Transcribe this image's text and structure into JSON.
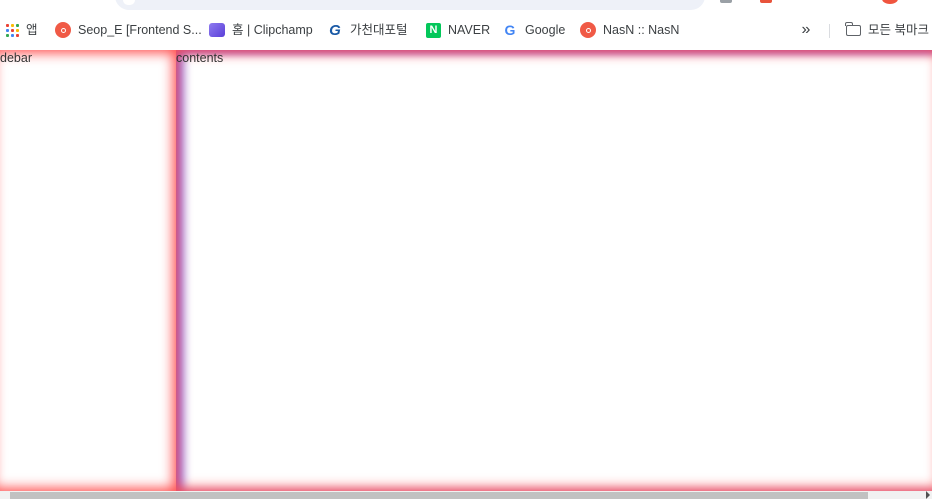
{
  "bookmarks": {
    "apps": {
      "label": "앱",
      "icon": "apps-grid-icon"
    },
    "items": [
      {
        "label": "Seop_E [Frontend S...",
        "icon": "velog-favicon"
      },
      {
        "label": "홈 | Clipchamp",
        "icon": "clipchamp-favicon"
      },
      {
        "label": "가천대포털",
        "icon": "gachon-favicon"
      },
      {
        "label": "NAVER",
        "icon": "naver-favicon"
      },
      {
        "label": "Google",
        "icon": "google-favicon"
      },
      {
        "label": "NasN :: NasN",
        "icon": "velog-favicon"
      }
    ],
    "more": "»",
    "all_bookmarks": "모든 북마크"
  },
  "page": {
    "sidebar_label": "sidebar",
    "contents_label": "contents"
  },
  "colors": {
    "sidebar_glow": "#ff4f4f",
    "contents_left_glow": "#5a5aff",
    "contents_top_glow": "#8a4fd8"
  }
}
